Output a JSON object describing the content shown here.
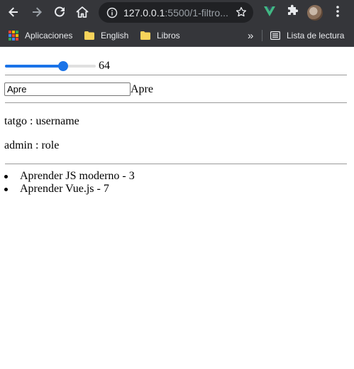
{
  "browser": {
    "url_host": "127.0.0.1",
    "url_rest": ":5500/1-filtro...",
    "icons": [
      "back-icon",
      "forward-icon",
      "reload-icon",
      "home-icon",
      "info-icon",
      "star-icon",
      "vue-devtools-icon",
      "extensions-icon",
      "profile-avatar",
      "menu-icon"
    ],
    "colors": {
      "chrome": "#35363a",
      "omnibox": "#202124",
      "vue": "#41b883"
    }
  },
  "bookmarks": {
    "apps_label": "Aplicaciones",
    "items": [
      {
        "label": "English"
      },
      {
        "label": "Libros"
      }
    ],
    "overflow": "»",
    "reading_list_label": "Lista de lectura",
    "folder_color": "#f6d35b"
  },
  "page": {
    "slider": {
      "value": "64",
      "level": 0.64,
      "accent": "#1a73e8"
    },
    "filter": {
      "input_value": "Apre",
      "echo": "Apre"
    },
    "user": {
      "username_line": "tatgo : username",
      "role_line": "admin : role"
    },
    "todos": [
      {
        "text": "Aprender JS moderno - 3"
      },
      {
        "text": "Aprender Vue.js - 7"
      }
    ]
  }
}
